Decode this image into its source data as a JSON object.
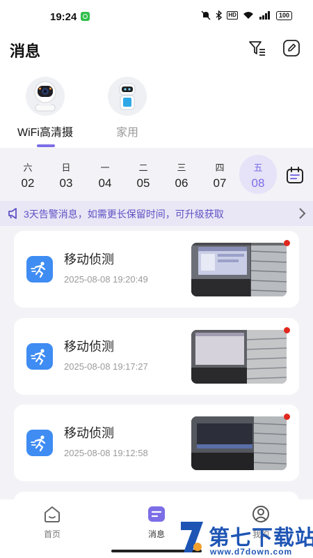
{
  "status_bar": {
    "time": "19:24",
    "icons": [
      "mute-icon",
      "bluetooth-icon",
      "hd-icon",
      "wifi-icon",
      "signal-icon"
    ],
    "hd_label": "HD",
    "battery": "100"
  },
  "header": {
    "title": "消息",
    "filter_icon": "filter-icon",
    "edit_icon": "edit-icon"
  },
  "devices": [
    {
      "name": "WiFi高清摄",
      "selected": true
    },
    {
      "name": "家用",
      "selected": false
    }
  ],
  "dates": [
    {
      "dow": "六",
      "day": "02"
    },
    {
      "dow": "日",
      "day": "03"
    },
    {
      "dow": "一",
      "day": "04"
    },
    {
      "dow": "二",
      "day": "05"
    },
    {
      "dow": "三",
      "day": "06"
    },
    {
      "dow": "四",
      "day": "07"
    },
    {
      "dow": "五",
      "day": "08",
      "selected": true
    }
  ],
  "banner": {
    "text": "3天告警消息，如需更长保留时间，可升级获取"
  },
  "events": [
    {
      "title": "移动侦测",
      "time": "2025-08-08 19:20:49",
      "unread": true
    },
    {
      "title": "移动侦测",
      "time": "2025-08-08 19:17:27",
      "unread": true
    },
    {
      "title": "移动侦测",
      "time": "2025-08-08 19:12:58",
      "unread": true
    }
  ],
  "tabs": [
    {
      "label": "首页",
      "icon": "home-icon"
    },
    {
      "label": "消息",
      "icon": "message-icon",
      "active": true
    },
    {
      "label": "我的",
      "icon": "profile-icon"
    }
  ],
  "watermark": {
    "brand": "第七下载站",
    "url": "www.d7down.com"
  },
  "colors": {
    "accent": "#7b6ee6",
    "event_icon": "#3f8cf3",
    "unread_dot": "#e0281e",
    "watermark": "#1e55b4"
  }
}
